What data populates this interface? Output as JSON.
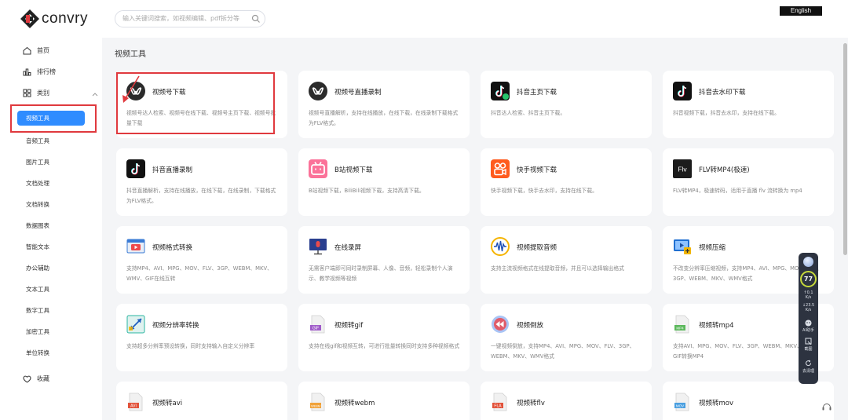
{
  "header": {
    "logo_text": "convry",
    "search_placeholder": "输入关键词搜索，如视频编辑、pdf拆分等",
    "lang_button": "English"
  },
  "sidebar": {
    "home": "首页",
    "rank": "排行榜",
    "category": "类别",
    "active_item": "视频工具",
    "items": [
      "音频工具",
      "图片工具",
      "文档处理",
      "文档转换",
      "数据图表",
      "智能文本",
      "办公辅助",
      "文本工具",
      "数字工具",
      "加密工具",
      "单位转换"
    ],
    "favorites": "收藏"
  },
  "main": {
    "section_title": "视频工具",
    "cards": [
      {
        "title": "视频号下载",
        "desc": "视频号达人检索、视频号在线下载、视频号主页下载、视频号批量下载",
        "icon": "wechat-channels-icon"
      },
      {
        "title": "视频号直播录制",
        "desc": "视频号直播解析，支持在线播放，在线下载，在线录制下载格式为FLV格式。",
        "icon": "wechat-channels-icon"
      },
      {
        "title": "抖音主页下载",
        "desc": "抖音达人检索、抖音主页下载。",
        "icon": "douyin-icon"
      },
      {
        "title": "抖音去水印下载",
        "desc": "抖音视频下载，抖音去水印，支持在线下载。",
        "icon": "douyin-icon"
      },
      {
        "title": "抖音直播录制",
        "desc": "抖音直播解析，支持在线播放，在线下载，在线录制，下载格式为FLV格式。",
        "icon": "douyin-icon"
      },
      {
        "title": "B站视频下载",
        "desc": "B站视频下载，BiliBili视频下载，支持高清下载。",
        "icon": "bilibili-icon"
      },
      {
        "title": "快手视频下载",
        "desc": "快手视频下载，快手去水印，支持在线下载。",
        "icon": "kuaishou-icon"
      },
      {
        "title": "FLV转MP4(极速)",
        "desc": "FLV转MP4，极速转码，适用于直播 flv 流转换为 mp4",
        "icon": "flv-icon"
      },
      {
        "title": "视频格式转换",
        "desc": "支持MP4、AVI、MPG、MOV、FLV、3GP、WEBM、MKV、WMV、GIF在线互转",
        "icon": "video-convert-icon"
      },
      {
        "title": "在线录屏",
        "desc": "无需客户端即可同时录制屏幕、人像、音频，轻松录制个人演示、教学视频等视频",
        "icon": "screen-record-icon"
      },
      {
        "title": "视频提取音频",
        "desc": "支持主流视频格式在线提取音频，并且可以选择输出格式",
        "icon": "audio-extract-icon"
      },
      {
        "title": "视频压缩",
        "desc": "不改变分辨率压缩视频，支持MP4、AVI、MPG、MOV、FLV、3GP、WEBM、MKV、WMV格式",
        "icon": "video-compress-icon"
      },
      {
        "title": "视频分辨率转换",
        "desc": "支持超多分辨率预设转换，同时支持输入自定义分辨率",
        "icon": "resolution-icon"
      },
      {
        "title": "视频转gif",
        "desc": "支持在线gif和视频互转，可进行批量转换同时支持多种视频格式",
        "icon": "gif-file-icon"
      },
      {
        "title": "视频倒放",
        "desc": "一键视频倒放，支持MP4、AVI、MPG、MOV、FLV、3GP、WEBM、MKV、WMV格式",
        "icon": "rewind-icon"
      },
      {
        "title": "视频转mp4",
        "desc": "支持AVI、MPG、MOV、FLV、3GP、WEBM、MKV、WMV、GIF转换MP4",
        "icon": "mp4-file-icon"
      },
      {
        "title": "视频转avi",
        "desc": "",
        "icon": "avi-file-icon"
      },
      {
        "title": "视频转webm",
        "desc": "",
        "icon": "webm-file-icon"
      },
      {
        "title": "视频转flv",
        "desc": "",
        "icon": "fla-file-icon"
      },
      {
        "title": "视频转mov",
        "desc": "",
        "icon": "mov-file-icon"
      }
    ]
  },
  "widget": {
    "score": "77",
    "upload": "0.1",
    "upload_unit": "K/s",
    "download": "23.5",
    "download_unit": "K/s",
    "ai_label": "AI助手",
    "shot_label": "截图",
    "clean_label": "去清理"
  },
  "icon_labels": {
    "flv": "Flv",
    "gif": "GIF",
    "mp4": "MP4",
    "avi": "AVI",
    "webm": "WEBM",
    "fla": "FLA",
    "mov": "MOV"
  },
  "colors": {
    "accent": "#2f8cff",
    "highlight": "#e0393e"
  }
}
